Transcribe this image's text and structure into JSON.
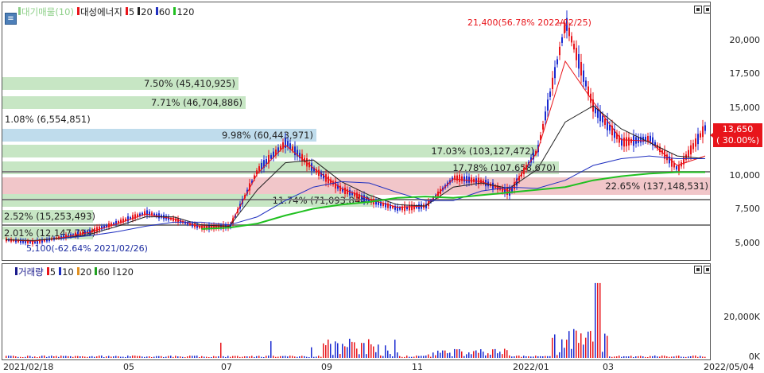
{
  "price_panel": {
    "legend": {
      "items": [
        {
          "label": "대기매물(10)",
          "color": "#8fd08a"
        },
        {
          "label": "대성에너지",
          "color": "#e8151b"
        },
        {
          "label": "5",
          "color": "#e8151b"
        },
        {
          "label": "20",
          "color": "#222222"
        },
        {
          "label": "60",
          "color": "#2030c0"
        },
        {
          "label": "120",
          "color": "#20c020"
        }
      ]
    },
    "bands": [
      {
        "label": "7.50% (45,410,925)"
      },
      {
        "label": "7.71% (46,704,886)"
      },
      {
        "label": "1.08% (6,554,851)"
      },
      {
        "label": "9.98% (60,443,971)"
      },
      {
        "label": "17.03% (103,127,472)"
      },
      {
        "label": "17.78% (107,658,670)"
      },
      {
        "label": "22.65% (137,148,531)"
      },
      {
        "label": "11.74% (71,093,844)"
      },
      {
        "label": "2.52% (15,253,493)"
      },
      {
        "label": "2.01% (12,147,739)"
      }
    ],
    "high_annotation": "21,400(56.78% 2022/02/25)",
    "low_annotation": "5,100(-62.64% 2021/02/26)",
    "current_price": "13,650",
    "current_change": "( 30.00%)",
    "y_ticks": [
      "20,000",
      "17,500",
      "15,000",
      "12,500",
      "10,000",
      "7,500",
      "5,000"
    ]
  },
  "volume_panel": {
    "legend": {
      "items": [
        {
          "label": "거래량",
          "color": "#1a1a8c"
        },
        {
          "label": "5",
          "color": "#e8151b"
        },
        {
          "label": "10",
          "color": "#2030c0"
        },
        {
          "label": "20",
          "color": "#e09020"
        },
        {
          "label": "60",
          "color": "#20a020"
        },
        {
          "label": "120",
          "color": "#a0a0a0"
        }
      ]
    },
    "y_ticks": [
      "20,000K",
      "0K"
    ]
  },
  "x_axis": {
    "labels": [
      "2021/02/18",
      "05",
      "07",
      "09",
      "11",
      "2022/01",
      "03",
      "2022/05/04"
    ]
  },
  "chart_data": {
    "type": "line",
    "title": "대성에너지",
    "x": [
      "2021/02/18",
      "2021/02/26",
      "2021/03",
      "2021/04",
      "2021/05",
      "2021/06",
      "2021/07",
      "2021/08",
      "2021/09/01",
      "2021/09/15",
      "2021/10/01",
      "2021/10/15",
      "2021/11/01",
      "2021/11/15",
      "2021/12/01",
      "2021/12/15",
      "2022/01/01",
      "2022/01/15",
      "2022/02/01",
      "2022/02/15",
      "2022/02/25",
      "2022/03/10",
      "2022/03/25",
      "2022/04/10",
      "2022/04/25",
      "2022/05/04"
    ],
    "series": [
      {
        "name": "대성에너지",
        "values": [
          5300,
          5100,
          5500,
          5900,
          6600,
          7300,
          6800,
          6200,
          6300,
          10500,
          12500,
          10500,
          9000,
          8200,
          7600,
          7800,
          9900,
          9600,
          8800,
          12000,
          21400,
          15000,
          12500,
          12800,
          10500,
          13650
        ]
      },
      {
        "name": "5",
        "values": [
          5300,
          5200,
          5450,
          5850,
          6500,
          7200,
          6850,
          6250,
          6300,
          10200,
          12300,
          10600,
          9100,
          8300,
          7700,
          7800,
          9800,
          9600,
          8900,
          11800,
          18500,
          15500,
          12700,
          12600,
          10800,
          11500
        ]
      },
      {
        "name": "20",
        "values": [
          5300,
          5250,
          5400,
          5700,
          6300,
          7000,
          7000,
          6400,
          6300,
          9000,
          11000,
          11200,
          9600,
          8600,
          7900,
          7800,
          9200,
          9500,
          9100,
          10500,
          14000,
          15200,
          13500,
          12500,
          11500,
          11300
        ]
      },
      {
        "name": "60",
        "values": [
          null,
          null,
          5400,
          5600,
          5900,
          6300,
          6600,
          6600,
          6400,
          7000,
          8200,
          9200,
          9600,
          9500,
          8800,
          8200,
          8200,
          8900,
          9200,
          9100,
          9700,
          10800,
          11300,
          11500,
          11300,
          11300
        ]
      },
      {
        "name": "120",
        "values": [
          null,
          null,
          null,
          null,
          null,
          null,
          null,
          6100,
          6200,
          6500,
          7100,
          7600,
          7900,
          8100,
          8400,
          8500,
          8400,
          8600,
          8800,
          9000,
          9200,
          9700,
          10000,
          10200,
          10300,
          10300
        ]
      }
    ],
    "ylim": [
      3800,
      22500
    ],
    "y_ticks": [
      5000,
      7500,
      10000,
      12500,
      15000,
      17500,
      20000
    ],
    "volume_ylim_k": [
      0,
      42000
    ],
    "volume_peak_k": 38000,
    "grid": false,
    "legend": "top-left"
  }
}
